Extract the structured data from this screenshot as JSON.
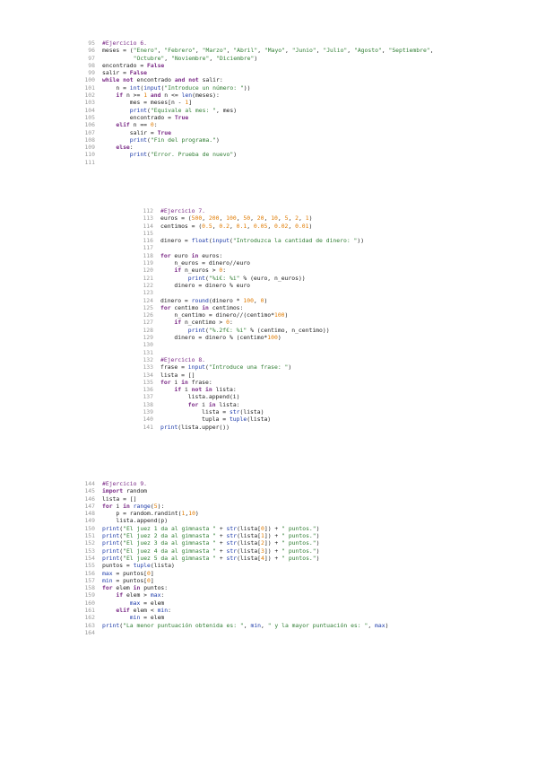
{
  "block1": {
    "lines": [
      {
        "n": "95",
        "t": "#Ejercicio 6."
      },
      {
        "n": "96",
        "t": "meses = (\"Enero\", \"Febrero\", \"Marzo\", \"Abril\", \"Mayo\", \"Junio\", \"Julio\", \"Agosto\", \"Septiembre\","
      },
      {
        "n": "97",
        "t": "         \"Octubre\", \"Noviembre\", \"Diciembre\")"
      },
      {
        "n": "98",
        "t": "encontrado = False"
      },
      {
        "n": "99",
        "t": "salir = False"
      },
      {
        "n": "100",
        "t": "while not encontrado and not salir:"
      },
      {
        "n": "101",
        "t": "    n = int(input(\"Introduce un número: \"))"
      },
      {
        "n": "102",
        "t": "    if n >= 1 and n <= len(meses):"
      },
      {
        "n": "103",
        "t": "        mes = meses[n - 1]"
      },
      {
        "n": "104",
        "t": "        print(\"Equivale al mes: \", mes)"
      },
      {
        "n": "105",
        "t": "        encontrado = True"
      },
      {
        "n": "106",
        "t": "    elif n == 0:"
      },
      {
        "n": "107",
        "t": "        salir = True"
      },
      {
        "n": "108",
        "t": "        print(\"Fin del programa.\")"
      },
      {
        "n": "109",
        "t": "    else:"
      },
      {
        "n": "110",
        "t": "        print(\"Error. Prueba de nuevo\")"
      },
      {
        "n": "111",
        "t": ""
      }
    ]
  },
  "block2": {
    "lines": [
      {
        "n": "112",
        "t": "#Ejercicio 7."
      },
      {
        "n": "113",
        "t": "euros = (500, 200, 100, 50, 20, 10, 5, 2, 1)"
      },
      {
        "n": "114",
        "t": "centimos = (0.5, 0.2, 0.1, 0.05, 0.02, 0.01)"
      },
      {
        "n": "115",
        "t": ""
      },
      {
        "n": "116",
        "t": "dinero = float(input(\"Introduzca la cantidad de dinero: \"))"
      },
      {
        "n": "117",
        "t": ""
      },
      {
        "n": "118",
        "t": "for euro in euros:"
      },
      {
        "n": "119",
        "t": "    n_euros = dinero//euro"
      },
      {
        "n": "120",
        "t": "    if n_euros > 0:"
      },
      {
        "n": "121",
        "t": "        print(\"%i€: %i\" % (euro, n_euros))"
      },
      {
        "n": "122",
        "t": "    dinero = dinero % euro"
      },
      {
        "n": "123",
        "t": ""
      },
      {
        "n": "124",
        "t": "dinero = round(dinero * 100, 0)"
      },
      {
        "n": "125",
        "t": "for centimo in centimos:"
      },
      {
        "n": "126",
        "t": "    n_centimo = dinero//(centimo*100)"
      },
      {
        "n": "127",
        "t": "    if n_centimo > 0:"
      },
      {
        "n": "128",
        "t": "        print(\"%.2f€: %i\" % (centimo, n_centimo))"
      },
      {
        "n": "129",
        "t": "    dinero = dinero % (centimo*100)"
      },
      {
        "n": "130",
        "t": ""
      },
      {
        "n": "131",
        "t": ""
      },
      {
        "n": "132",
        "t": "#Ejercicio 8."
      },
      {
        "n": "133",
        "t": "frase = input(\"Introduce una frase: \")"
      },
      {
        "n": "134",
        "t": "lista = []"
      },
      {
        "n": "135",
        "t": "for i in frase:"
      },
      {
        "n": "136",
        "t": "    if i not in lista:"
      },
      {
        "n": "137",
        "t": "        lista.append(i)"
      },
      {
        "n": "138",
        "t": "        for i in lista:"
      },
      {
        "n": "139",
        "t": "            lista = str(lista)"
      },
      {
        "n": "140",
        "t": "            tupla = tuple(lista)"
      },
      {
        "n": "141",
        "t": "print(lista.upper())"
      }
    ]
  },
  "block3": {
    "lines": [
      {
        "n": "144",
        "t": "#Ejercicio 9."
      },
      {
        "n": "145",
        "t": "import random"
      },
      {
        "n": "146",
        "t": "lista = []"
      },
      {
        "n": "147",
        "t": "for i in range(5):"
      },
      {
        "n": "148",
        "t": "    p = random.randint(1,10)"
      },
      {
        "n": "149",
        "t": "    lista.append(p)"
      },
      {
        "n": "150",
        "t": "print(\"El juez 1 da al gimnasta \" + str(lista[0]) + \" puntos.\")"
      },
      {
        "n": "151",
        "t": "print(\"El juez 2 da al gimnasta \" + str(lista[1]) + \" puntos.\")"
      },
      {
        "n": "152",
        "t": "print(\"El juez 3 da al gimnasta \" + str(lista[2]) + \" puntos.\")"
      },
      {
        "n": "153",
        "t": "print(\"El juez 4 da al gimnasta \" + str(lista[3]) + \" puntos.\")"
      },
      {
        "n": "154",
        "t": "print(\"El juez 5 da al gimnasta \" + str(lista[4]) + \" puntos.\")"
      },
      {
        "n": "155",
        "t": "puntos = tuple(lista)"
      },
      {
        "n": "156",
        "t": "max = puntos[0]"
      },
      {
        "n": "157",
        "t": "min = puntos[0]"
      },
      {
        "n": "158",
        "t": "for elem in puntos:"
      },
      {
        "n": "159",
        "t": "    if elem > max:"
      },
      {
        "n": "160",
        "t": "        max = elem"
      },
      {
        "n": "161",
        "t": "    elif elem < min:"
      },
      {
        "n": "162",
        "t": "        min = elem"
      },
      {
        "n": "163",
        "t": "print(\"La menor puntuación obtenida es: \", min, \" y la mayor puntuación es: \", max)"
      },
      {
        "n": "164",
        "t": ""
      }
    ]
  }
}
